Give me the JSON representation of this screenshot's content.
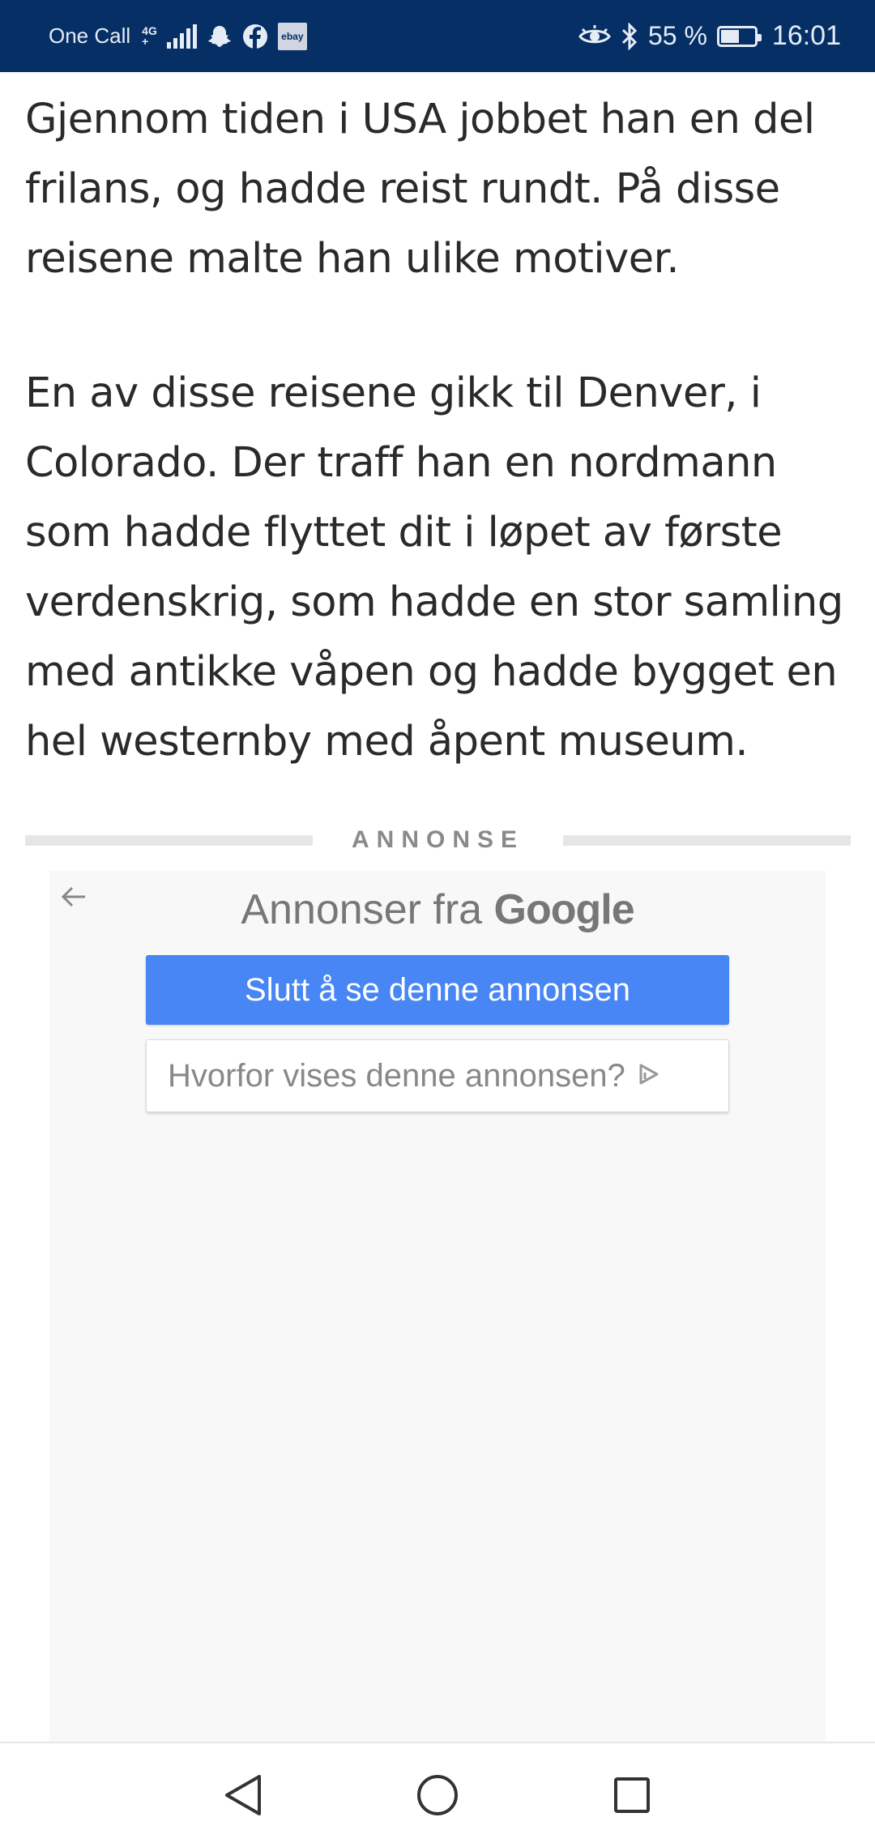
{
  "status_bar": {
    "carrier": "One Call",
    "network_type": "4G",
    "network_sub": "+",
    "notification_icons": [
      "snapchat-icon",
      "facebook-icon",
      "ebay-icon"
    ],
    "ebay_label": "ebay",
    "battery_percent": "55 %",
    "battery_level": 0.55,
    "time": "16:01"
  },
  "article": {
    "paragraphs": [
      "Gjennom tiden i USA jobbet han en del frilans, og hadde reist rundt. På disse reisene malte han ulike motiver.",
      "En av disse reisene gikk til Denver, i Colorado. Der traff han en nordmann som hadde flyttet dit i løpet av første verdenskrig, som hadde en stor samling med antikke våpen og hadde bygget en hel westernby med åpent museum."
    ]
  },
  "ad": {
    "label": "ANNONSE",
    "title_prefix": "Annonser fra",
    "title_brand": "Google",
    "stop_button": "Slutt å se denne annonsen",
    "why_button": "Hvorfor vises denne annonsen?",
    "colors": {
      "stop_button": "#4786f4",
      "background": "#f8f8f8"
    }
  },
  "nav_bar": {
    "buttons": [
      "back-icon",
      "home-icon",
      "recents-icon"
    ]
  },
  "colors": {
    "status_bar": "#062f66",
    "text": "#2a2a2a"
  }
}
